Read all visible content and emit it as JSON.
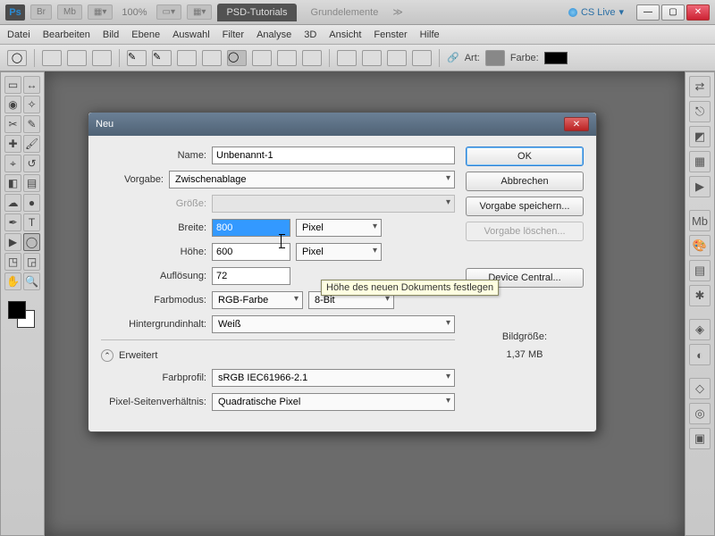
{
  "appbar": {
    "zoom": "100%",
    "tab_active": "PSD-Tutorials",
    "tab_inactive": "Grundelemente",
    "cslive": "CS Live"
  },
  "menu": [
    "Datei",
    "Bearbeiten",
    "Bild",
    "Ebene",
    "Auswahl",
    "Filter",
    "Analyse",
    "3D",
    "Ansicht",
    "Fenster",
    "Hilfe"
  ],
  "optbar": {
    "art": "Art:",
    "farbe": "Farbe:"
  },
  "dialog": {
    "title": "Neu",
    "labels": {
      "name": "Name:",
      "vorgabe": "Vorgabe:",
      "groesse": "Größe:",
      "breite": "Breite:",
      "hoehe": "Höhe:",
      "aufloesung": "Auflösung:",
      "farbmodus": "Farbmodus:",
      "hintergrund": "Hintergrundinhalt:",
      "erweitert": "Erweitert",
      "farbprofil": "Farbprofil:",
      "pixsv": "Pixel-Seitenverhältnis:",
      "bildgroesse": "Bildgröße:"
    },
    "values": {
      "name": "Unbenannt-1",
      "vorgabe": "Zwischenablage",
      "groesse": "",
      "breite": "800",
      "hoehe": "600",
      "aufloesung": "72",
      "unit_px": "Pixel",
      "farbmodus": "RGB-Farbe",
      "bittiefe": "8-Bit",
      "hintergrund": "Weiß",
      "farbprofil": "sRGB IEC61966-2.1",
      "pixsv": "Quadratische Pixel",
      "bildgroesse": "1,37 MB"
    },
    "buttons": {
      "ok": "OK",
      "abbrechen": "Abbrechen",
      "save_preset": "Vorgabe speichern...",
      "delete_preset": "Vorgabe löschen...",
      "device_central": "Device Central..."
    },
    "tooltip": "Höhe des neuen Dokuments festlegen"
  }
}
